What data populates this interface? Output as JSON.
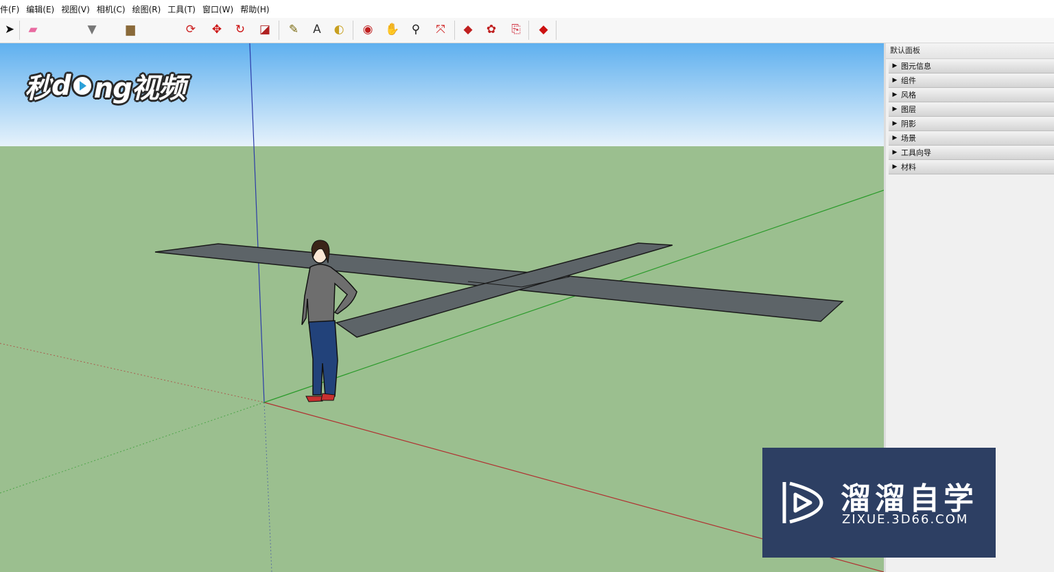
{
  "menu": [
    "件(F)",
    "编辑(E)",
    "视图(V)",
    "相机(C)",
    "绘图(R)",
    "工具(T)",
    "窗口(W)",
    "帮助(H)"
  ],
  "toolbar": {
    "tools": [
      {
        "name": "select-tool",
        "glyph": "➤",
        "color": "#111111"
      },
      {
        "name": "eraser-tool",
        "glyph": "▰",
        "color": "#e86aa0"
      },
      {
        "name": "paint-bucket-tool",
        "glyph": "▼",
        "color": "#777777"
      },
      {
        "name": "push-pull-tool",
        "glyph": "▆",
        "color": "#8a6a3a"
      },
      {
        "name": "offset-tool",
        "glyph": "⟳",
        "color": "#cc2222"
      },
      {
        "name": "move-tool",
        "glyph": "✥",
        "color": "#cc1111"
      },
      {
        "name": "rotate-tool",
        "glyph": "↻",
        "color": "#cc1111"
      },
      {
        "name": "scale-tool",
        "glyph": "◪",
        "color": "#b02020"
      },
      {
        "name": "tape-measure-tool",
        "glyph": "✎",
        "color": "#7a6a10"
      },
      {
        "name": "text-tool",
        "glyph": "A",
        "color": "#333333"
      },
      {
        "name": "paint-tool",
        "glyph": "◐",
        "color": "#c8a020"
      },
      {
        "name": "orbit-tool",
        "glyph": "◉",
        "color": "#c02020"
      },
      {
        "name": "pan-tool",
        "glyph": "✋",
        "color": "#d4b070"
      },
      {
        "name": "zoom-tool",
        "glyph": "⚲",
        "color": "#1a1a1a"
      },
      {
        "name": "zoom-extents-tool",
        "glyph": "⤧",
        "color": "#cc1111"
      },
      {
        "name": "3d-warehouse-tool",
        "glyph": "◆",
        "color": "#c02020"
      },
      {
        "name": "components-tool",
        "glyph": "✿",
        "color": "#c02020"
      },
      {
        "name": "share-model-tool",
        "glyph": "⎘",
        "color": "#d03040"
      },
      {
        "name": "ruby-tool",
        "glyph": "◆",
        "color": "#cc1111"
      }
    ]
  },
  "brand": {
    "text_a": "秒",
    "text_b": "d",
    "text_c": "ng视频"
  },
  "panel": {
    "title": "默认面板",
    "trays": [
      "图元信息",
      "组件",
      "风格",
      "图层",
      "阴影",
      "场景",
      "工具向导",
      "材料"
    ]
  },
  "watermark": {
    "title": "溜溜自学",
    "url": "ZIXUE.3D66.COM"
  },
  "colors": {
    "sky_top": "#5fb0ef",
    "sky_bottom": "#e6f2fb",
    "ground": "#9bbf8f",
    "shape_fill": "#5d6468",
    "axis_blue": "#2a3aa8",
    "axis_red": "#b03030",
    "axis_green": "#2a9a2a",
    "watermark_bg": "#2d3f63"
  }
}
